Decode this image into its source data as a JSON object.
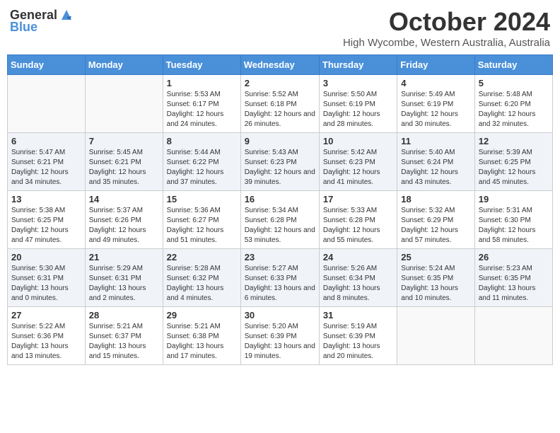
{
  "logo": {
    "text_general": "General",
    "text_blue": "Blue"
  },
  "title": "October 2024",
  "location": "High Wycombe, Western Australia, Australia",
  "days_of_week": [
    "Sunday",
    "Monday",
    "Tuesday",
    "Wednesday",
    "Thursday",
    "Friday",
    "Saturday"
  ],
  "weeks": [
    [
      {
        "day": "",
        "info": ""
      },
      {
        "day": "",
        "info": ""
      },
      {
        "day": "1",
        "info": "Sunrise: 5:53 AM\nSunset: 6:17 PM\nDaylight: 12 hours and 24 minutes."
      },
      {
        "day": "2",
        "info": "Sunrise: 5:52 AM\nSunset: 6:18 PM\nDaylight: 12 hours and 26 minutes."
      },
      {
        "day": "3",
        "info": "Sunrise: 5:50 AM\nSunset: 6:19 PM\nDaylight: 12 hours and 28 minutes."
      },
      {
        "day": "4",
        "info": "Sunrise: 5:49 AM\nSunset: 6:19 PM\nDaylight: 12 hours and 30 minutes."
      },
      {
        "day": "5",
        "info": "Sunrise: 5:48 AM\nSunset: 6:20 PM\nDaylight: 12 hours and 32 minutes."
      }
    ],
    [
      {
        "day": "6",
        "info": "Sunrise: 5:47 AM\nSunset: 6:21 PM\nDaylight: 12 hours and 34 minutes."
      },
      {
        "day": "7",
        "info": "Sunrise: 5:45 AM\nSunset: 6:21 PM\nDaylight: 12 hours and 35 minutes."
      },
      {
        "day": "8",
        "info": "Sunrise: 5:44 AM\nSunset: 6:22 PM\nDaylight: 12 hours and 37 minutes."
      },
      {
        "day": "9",
        "info": "Sunrise: 5:43 AM\nSunset: 6:23 PM\nDaylight: 12 hours and 39 minutes."
      },
      {
        "day": "10",
        "info": "Sunrise: 5:42 AM\nSunset: 6:23 PM\nDaylight: 12 hours and 41 minutes."
      },
      {
        "day": "11",
        "info": "Sunrise: 5:40 AM\nSunset: 6:24 PM\nDaylight: 12 hours and 43 minutes."
      },
      {
        "day": "12",
        "info": "Sunrise: 5:39 AM\nSunset: 6:25 PM\nDaylight: 12 hours and 45 minutes."
      }
    ],
    [
      {
        "day": "13",
        "info": "Sunrise: 5:38 AM\nSunset: 6:25 PM\nDaylight: 12 hours and 47 minutes."
      },
      {
        "day": "14",
        "info": "Sunrise: 5:37 AM\nSunset: 6:26 PM\nDaylight: 12 hours and 49 minutes."
      },
      {
        "day": "15",
        "info": "Sunrise: 5:36 AM\nSunset: 6:27 PM\nDaylight: 12 hours and 51 minutes."
      },
      {
        "day": "16",
        "info": "Sunrise: 5:34 AM\nSunset: 6:28 PM\nDaylight: 12 hours and 53 minutes."
      },
      {
        "day": "17",
        "info": "Sunrise: 5:33 AM\nSunset: 6:28 PM\nDaylight: 12 hours and 55 minutes."
      },
      {
        "day": "18",
        "info": "Sunrise: 5:32 AM\nSunset: 6:29 PM\nDaylight: 12 hours and 57 minutes."
      },
      {
        "day": "19",
        "info": "Sunrise: 5:31 AM\nSunset: 6:30 PM\nDaylight: 12 hours and 58 minutes."
      }
    ],
    [
      {
        "day": "20",
        "info": "Sunrise: 5:30 AM\nSunset: 6:31 PM\nDaylight: 13 hours and 0 minutes."
      },
      {
        "day": "21",
        "info": "Sunrise: 5:29 AM\nSunset: 6:31 PM\nDaylight: 13 hours and 2 minutes."
      },
      {
        "day": "22",
        "info": "Sunrise: 5:28 AM\nSunset: 6:32 PM\nDaylight: 13 hours and 4 minutes."
      },
      {
        "day": "23",
        "info": "Sunrise: 5:27 AM\nSunset: 6:33 PM\nDaylight: 13 hours and 6 minutes."
      },
      {
        "day": "24",
        "info": "Sunrise: 5:26 AM\nSunset: 6:34 PM\nDaylight: 13 hours and 8 minutes."
      },
      {
        "day": "25",
        "info": "Sunrise: 5:24 AM\nSunset: 6:35 PM\nDaylight: 13 hours and 10 minutes."
      },
      {
        "day": "26",
        "info": "Sunrise: 5:23 AM\nSunset: 6:35 PM\nDaylight: 13 hours and 11 minutes."
      }
    ],
    [
      {
        "day": "27",
        "info": "Sunrise: 5:22 AM\nSunset: 6:36 PM\nDaylight: 13 hours and 13 minutes."
      },
      {
        "day": "28",
        "info": "Sunrise: 5:21 AM\nSunset: 6:37 PM\nDaylight: 13 hours and 15 minutes."
      },
      {
        "day": "29",
        "info": "Sunrise: 5:21 AM\nSunset: 6:38 PM\nDaylight: 13 hours and 17 minutes."
      },
      {
        "day": "30",
        "info": "Sunrise: 5:20 AM\nSunset: 6:39 PM\nDaylight: 13 hours and 19 minutes."
      },
      {
        "day": "31",
        "info": "Sunrise: 5:19 AM\nSunset: 6:39 PM\nDaylight: 13 hours and 20 minutes."
      },
      {
        "day": "",
        "info": ""
      },
      {
        "day": "",
        "info": ""
      }
    ]
  ]
}
